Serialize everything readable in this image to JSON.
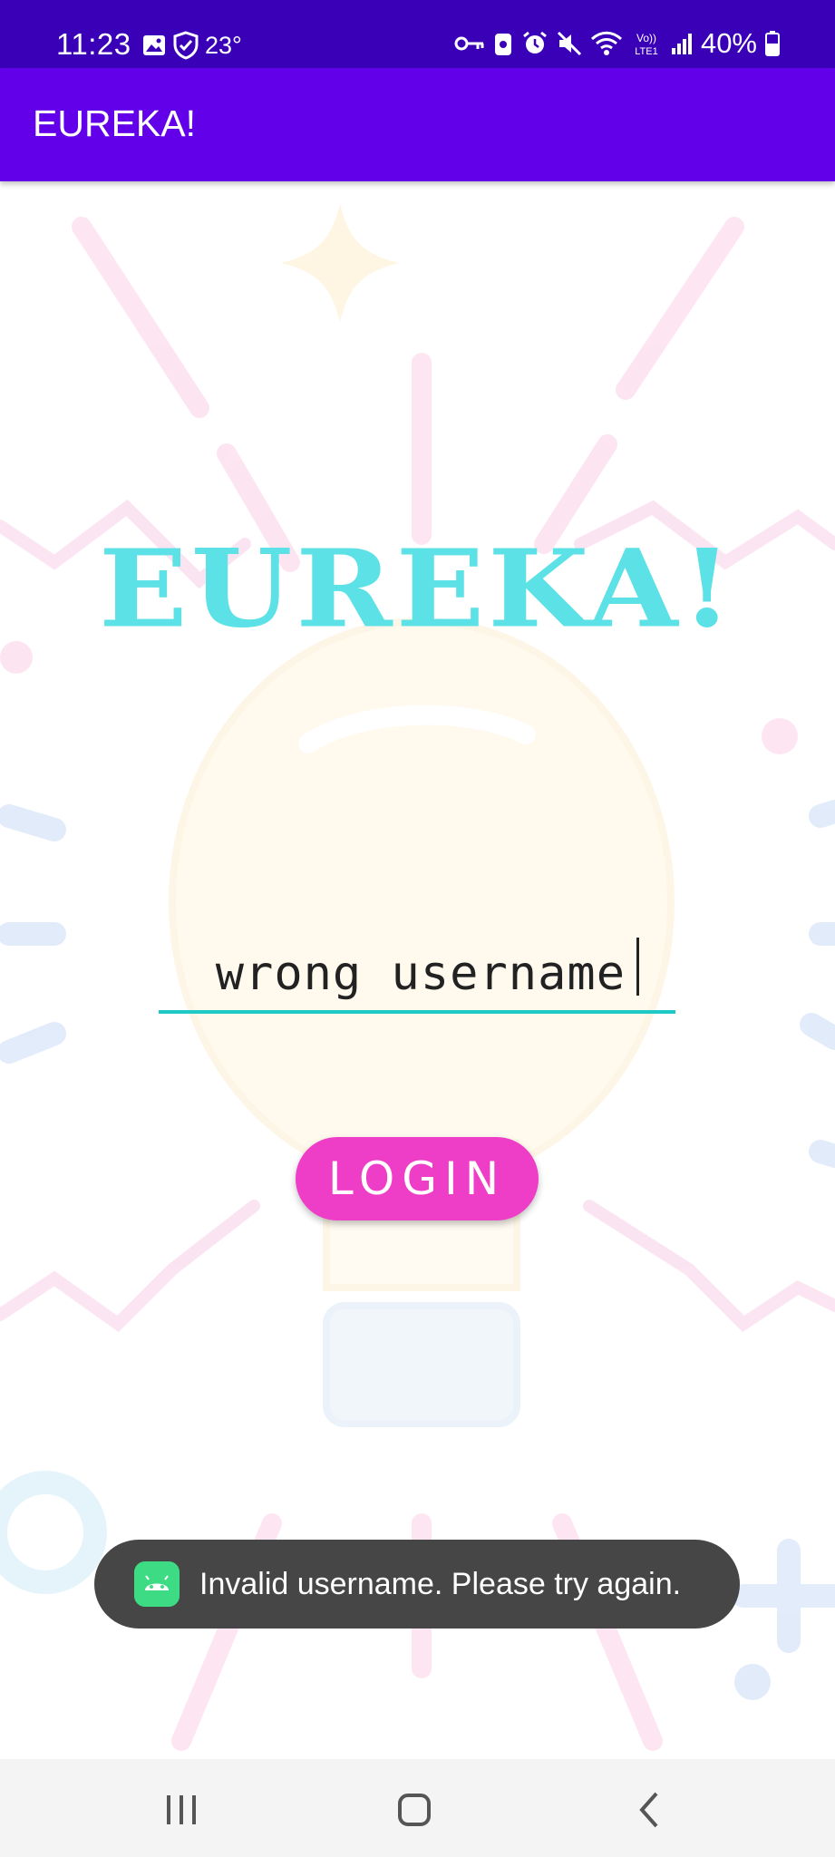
{
  "status": {
    "time": "11:23",
    "temperature": "23°",
    "battery": "40%",
    "left_icons": [
      "gallery-icon",
      "shield-icon"
    ],
    "right_icons": [
      "key-icon",
      "cleaner-icon",
      "alarm-icon",
      "mute-icon",
      "wifi-icon",
      "volte-icon",
      "signal-icon",
      "battery-icon"
    ]
  },
  "app_bar": {
    "title": "EUREKA!"
  },
  "main": {
    "logo_text": "EUREKA!",
    "username_value": "wrong username",
    "login_label": "LOGIN"
  },
  "toast": {
    "message": "Invalid username. Please try again."
  },
  "nav": {
    "items": [
      "recents-icon",
      "home-icon",
      "back-icon"
    ]
  },
  "colors": {
    "status_bar": "#3a00b8",
    "app_bar": "#6200ea",
    "logo": "#5ce1e6",
    "field_underline": "#1ec9c6",
    "login_button": "#ee3dc6",
    "toast": "#464646"
  }
}
